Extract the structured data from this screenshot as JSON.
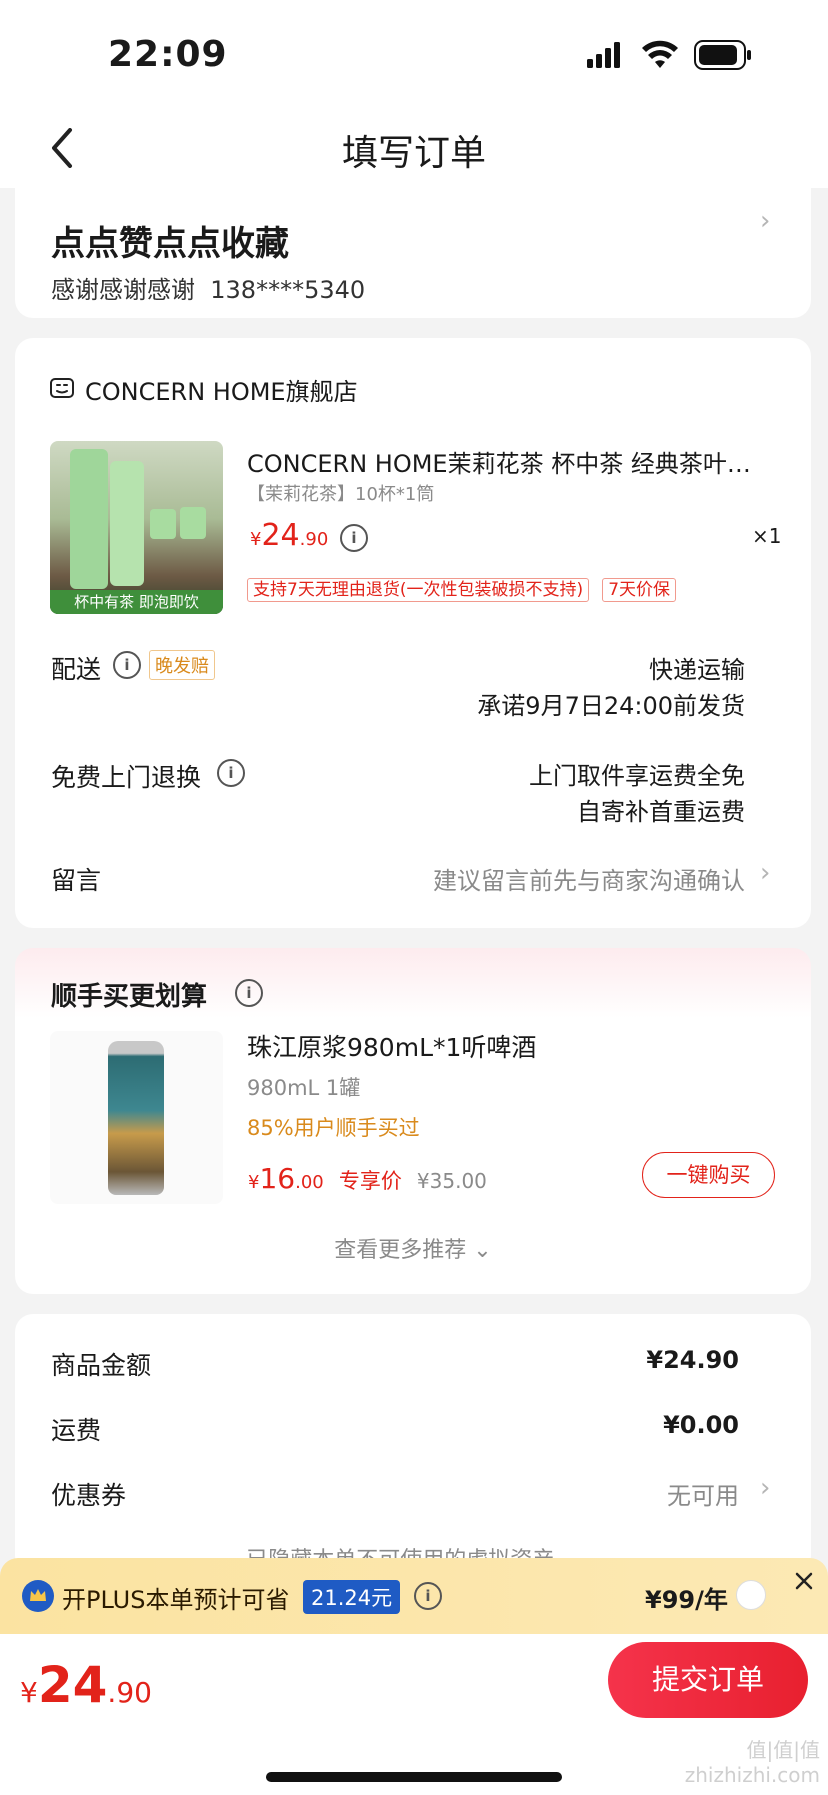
{
  "status": {
    "time": "22:09"
  },
  "nav": {
    "title": "填写订单"
  },
  "address": {
    "name": "点点赞点点收藏",
    "contact": "感谢感谢感谢",
    "phone": "138****5340"
  },
  "shop": {
    "name": "CONCERN HOME旗舰店"
  },
  "product": {
    "title": "CONCERN HOME茉莉花茶 杯中茶 经典茶叶…",
    "spec": "【茉莉花茶】10杯*1筒",
    "price_symbol": "¥",
    "price_int": "24",
    "price_dec": ".90",
    "qty": "×1",
    "image_caption": "杯中有茶 即泡即饮",
    "tags": [
      "支持7天无理由退货(一次性包装破损不支持)",
      "7天价保"
    ]
  },
  "delivery": {
    "label": "配送",
    "badge": "晚发赔",
    "method": "快递运输",
    "promise": "承诺9月7日24:00前发货"
  },
  "returns": {
    "label": "免费上门退换",
    "line1": "上门取件享运费全免",
    "line2": "自寄补首重运费"
  },
  "note": {
    "label": "留言",
    "placeholder": "建议留言前先与商家沟通确认"
  },
  "recommend": {
    "title": "顺手买更划算",
    "item": {
      "name": "珠江原浆980mL*1听啤酒",
      "spec": "980mL 1罐",
      "stat": "85%用户顺手买过",
      "price_symbol": "¥",
      "price_int": "16",
      "price_dec": ".00",
      "price_tag": "专享价",
      "orig_price": "¥35.00",
      "buy_label": "一键购买"
    },
    "more": "查看更多推荐"
  },
  "summary": {
    "goods_label": "商品金额",
    "goods_value": "¥24.90",
    "shipping_label": "运费",
    "shipping_value": "¥0.00",
    "coupon_label": "优惠券",
    "coupon_value": "无可用",
    "hidden_note": "已隐藏本单不可使用的虚拟资产"
  },
  "plus": {
    "text": "开PLUS本单预计可省",
    "saving": "21.24元",
    "price": "¥99/年"
  },
  "bottom": {
    "price_symbol": "¥",
    "price_int": "24",
    "price_dec": ".90",
    "submit_label": "提交订单"
  },
  "watermark": "值|值|值 zhizhizhi.com",
  "colors": {
    "accent": "#e2231a",
    "plus_bar": "#fbe3a1",
    "plus_badge": "#1f5bc4"
  }
}
